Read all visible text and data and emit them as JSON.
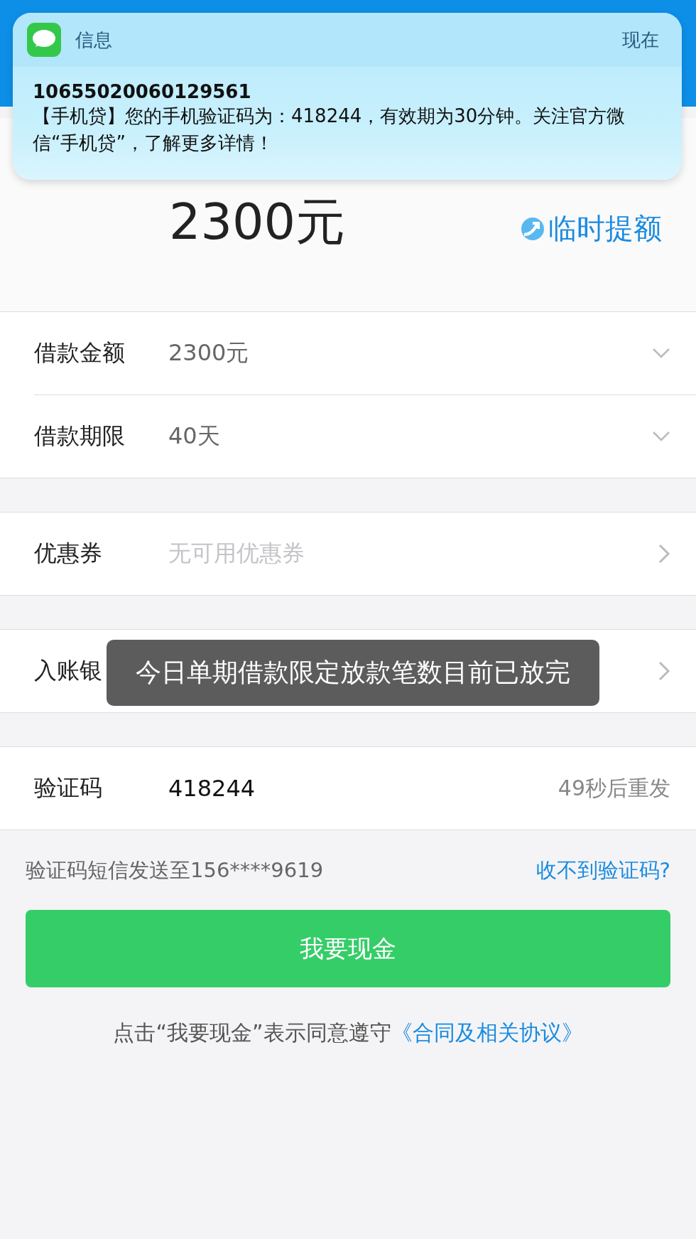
{
  "notification": {
    "app": "信息",
    "time": "现在",
    "sender": "10655020060129561",
    "body": "【手机贷】您的手机验证码为：418244，有效期为30分钟。关注官方微信“手机贷”，了解更多详情！"
  },
  "credit": {
    "amount": "2300元",
    "raise_link": "临时提额"
  },
  "groups": [
    {
      "rows": [
        {
          "kind": "select",
          "label": "借款金额",
          "value": "2300元"
        },
        {
          "kind": "select",
          "label": "借款期限",
          "value": "40天"
        }
      ]
    },
    {
      "rows": [
        {
          "kind": "link",
          "label": "优惠券",
          "placeholder": "无可用优惠券"
        }
      ]
    },
    {
      "rows": [
        {
          "kind": "link",
          "label": "入账银"
        }
      ]
    },
    {
      "rows": [
        {
          "kind": "code",
          "label": "验证码",
          "value": "418244",
          "resend": "49秒后重发"
        }
      ]
    }
  ],
  "sms_note": {
    "text": "验证码短信发送至156****9619",
    "help_link": "收不到验证码?"
  },
  "submit_button": "我要现金",
  "agreement": {
    "text": "点击“我要现金”表示同意遵守",
    "link": "《合同及相关协议》"
  },
  "toast": "今日单期借款限定放款笔数目前已放完"
}
